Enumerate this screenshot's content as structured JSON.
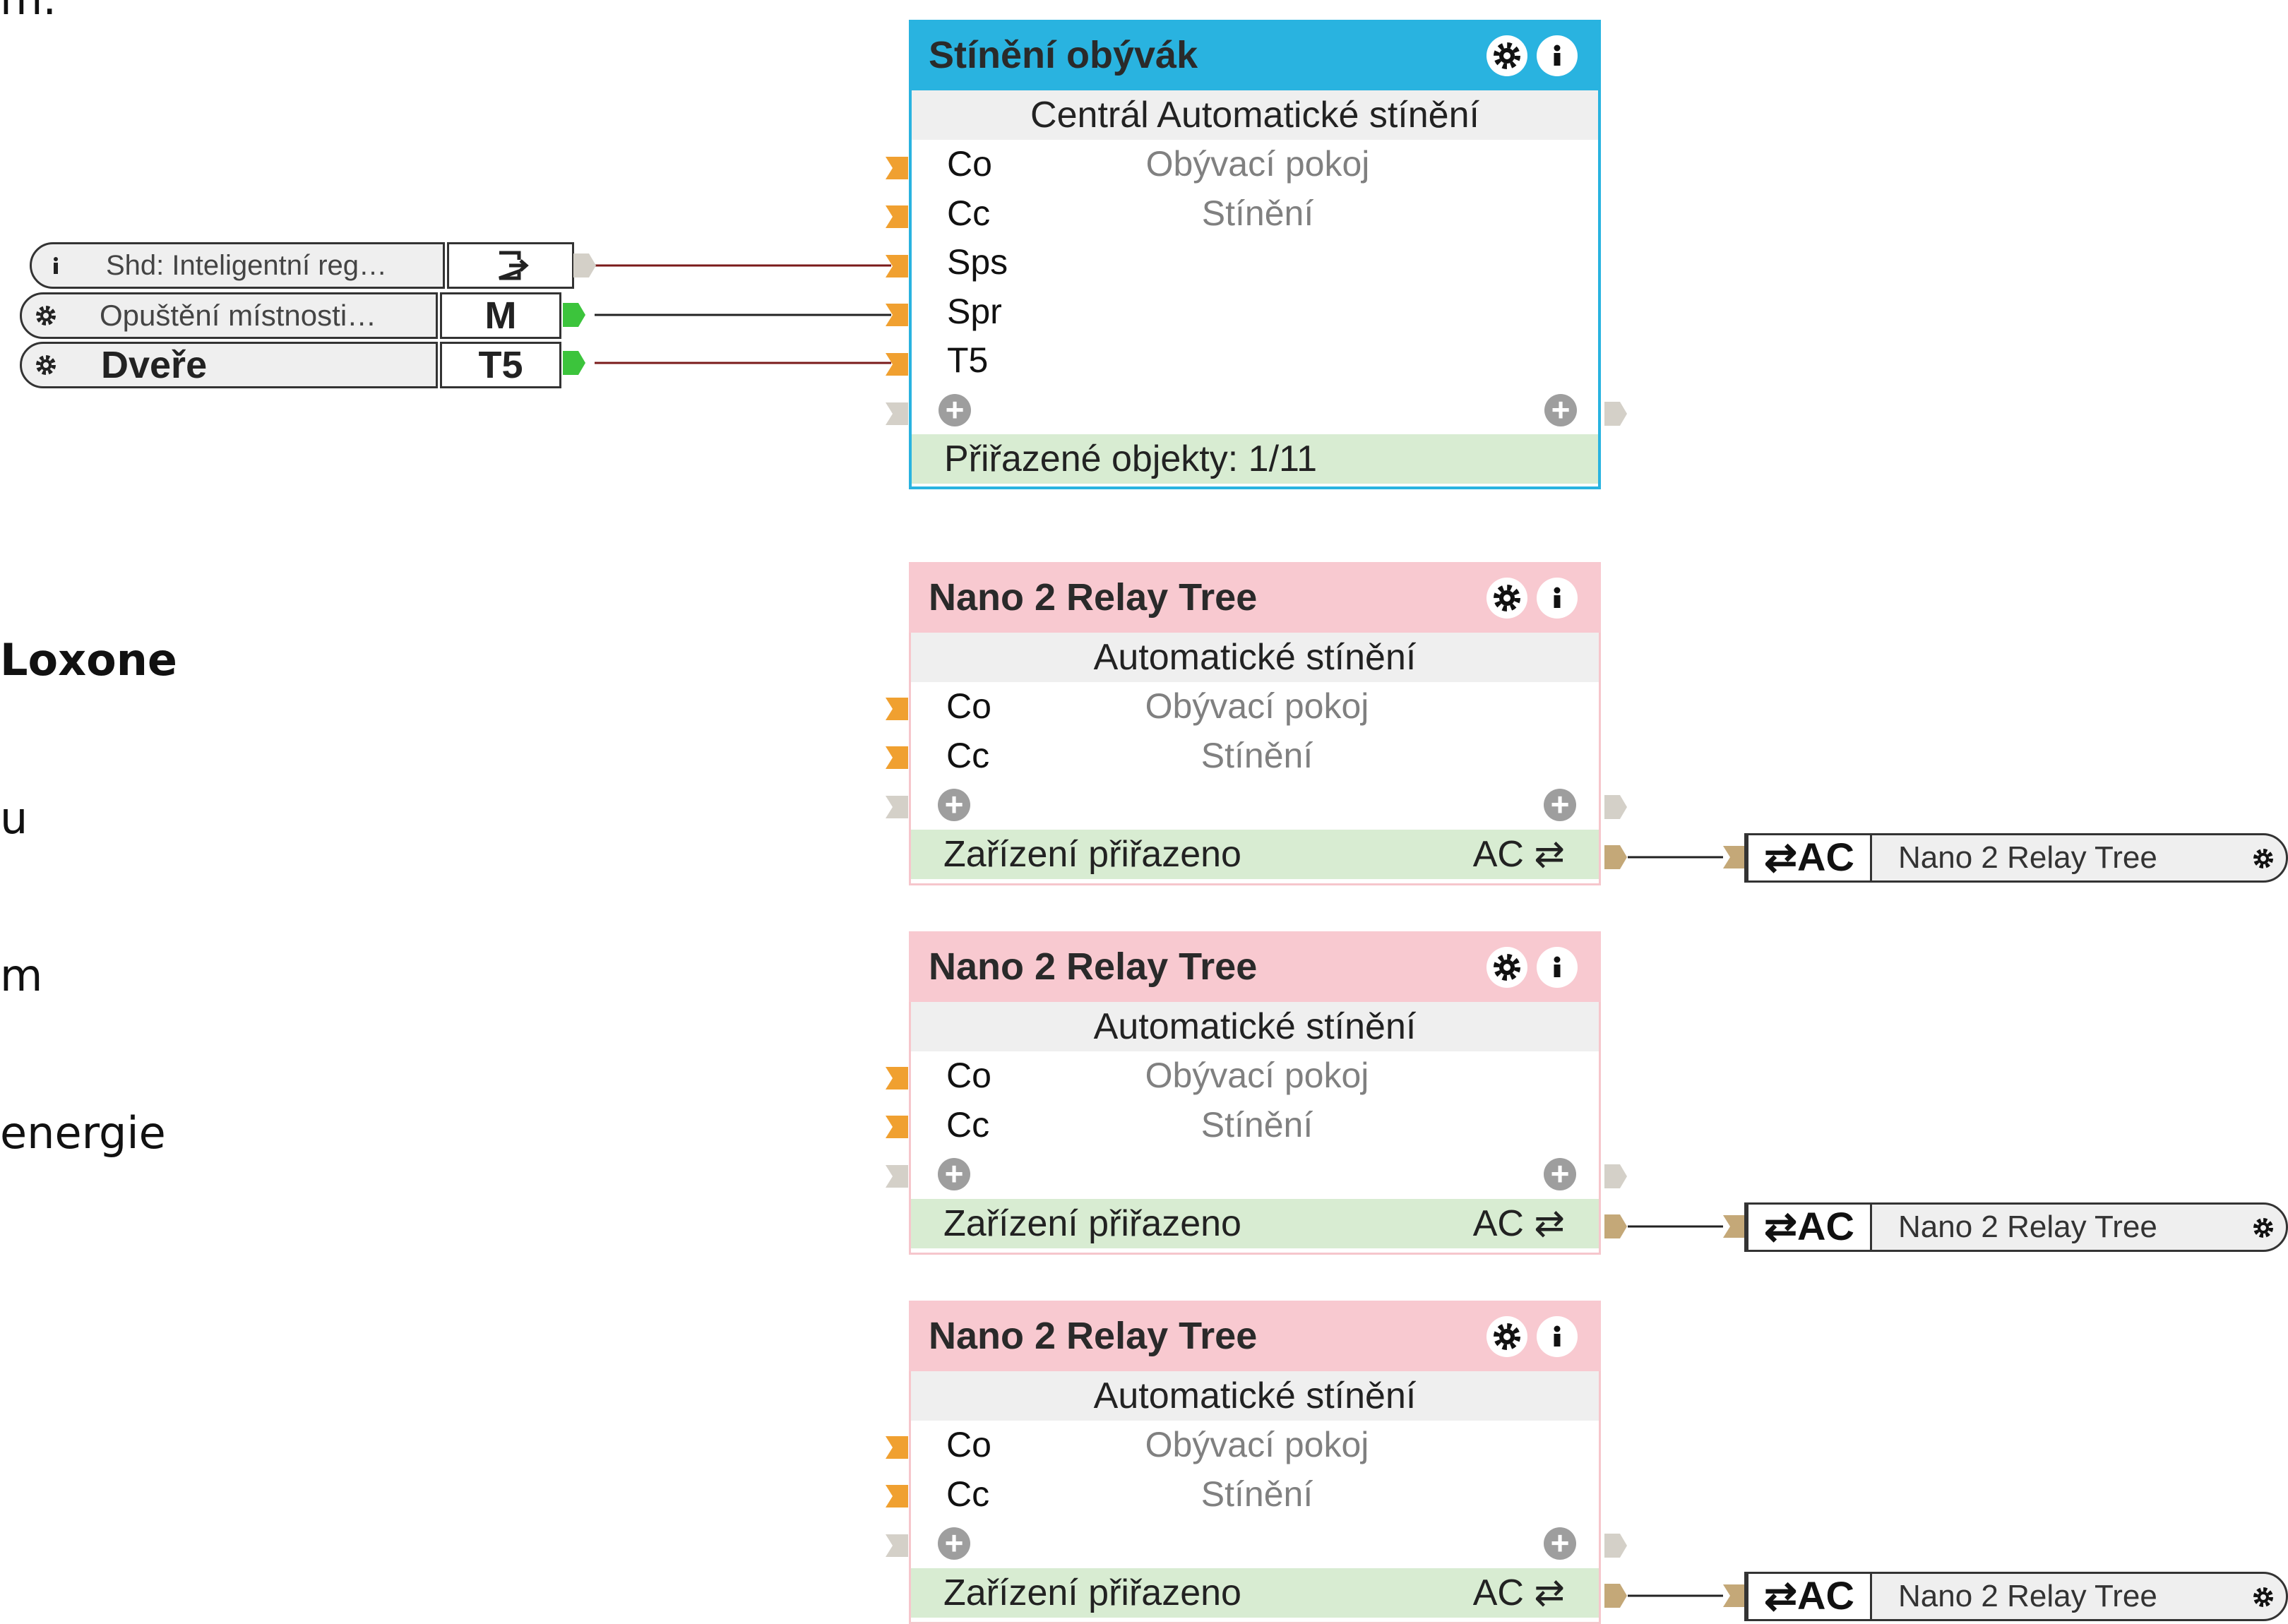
{
  "left_text": {
    "line0": "m.",
    "line1": "Loxone",
    "line2": "u",
    "line3": "m",
    "line4": "energie"
  },
  "inputs": [
    {
      "icon": "info-icon",
      "label": "Shd:  Inteligentní  reg…",
      "cell": "exit-icon"
    },
    {
      "icon": "gear-icon",
      "label": "Opuštění  místnosti…",
      "cell": "M"
    },
    {
      "icon": "gear-icon",
      "label": "Dveře",
      "cell": "T5"
    }
  ],
  "central_block": {
    "title": "Stínění obývák",
    "subtitle": "Centrál Automatické stínění",
    "rows": [
      {
        "pin": "Co",
        "value": "Obývací pokoj"
      },
      {
        "pin": "Cc",
        "value": "Stínění"
      },
      {
        "pin": "Sps",
        "value": ""
      },
      {
        "pin": "Spr",
        "value": ""
      },
      {
        "pin": "T5",
        "value": ""
      }
    ],
    "footer": "Přiřazené objekty: 1/11"
  },
  "relay_blocks": [
    {
      "title": "Nano 2 Relay Tree",
      "subtitle": "Automatické stínění",
      "rows": [
        {
          "pin": "Co",
          "value": "Obývací pokoj"
        },
        {
          "pin": "Cc",
          "value": "Stínění"
        }
      ],
      "footer": "Zařízení přiřazeno",
      "footer_ac": "AC ⇄"
    },
    {
      "title": "Nano 2 Relay Tree",
      "subtitle": "Automatické stínění",
      "rows": [
        {
          "pin": "Co",
          "value": "Obývací pokoj"
        },
        {
          "pin": "Cc",
          "value": "Stínění"
        }
      ],
      "footer": "Zařízení přiřazeno",
      "footer_ac": "AC ⇄"
    },
    {
      "title": "Nano 2 Relay Tree",
      "subtitle": "Automatické stínění",
      "rows": [
        {
          "pin": "Co",
          "value": "Obývací pokoj"
        },
        {
          "pin": "Cc",
          "value": "Stínění"
        }
      ],
      "footer": "Zařízení přiřazeno",
      "footer_ac": "AC ⇄"
    }
  ],
  "outputs": [
    {
      "ac": "⇄AC",
      "name": "Nano 2 Relay Tree"
    },
    {
      "ac": "⇄AC",
      "name": "Nano 2 Relay Tree"
    },
    {
      "ac": "⇄AC",
      "name": "Nano 2 Relay Tree"
    }
  ],
  "colors": {
    "central_header": "#29b3e0",
    "relay_header": "#f8c9d0",
    "footer_green": "#d8ecd2",
    "input_arrow": "#f0a030",
    "wire_red": "#7a1a1a",
    "wire_dark": "#222222",
    "active_output": "#3cc43c"
  }
}
